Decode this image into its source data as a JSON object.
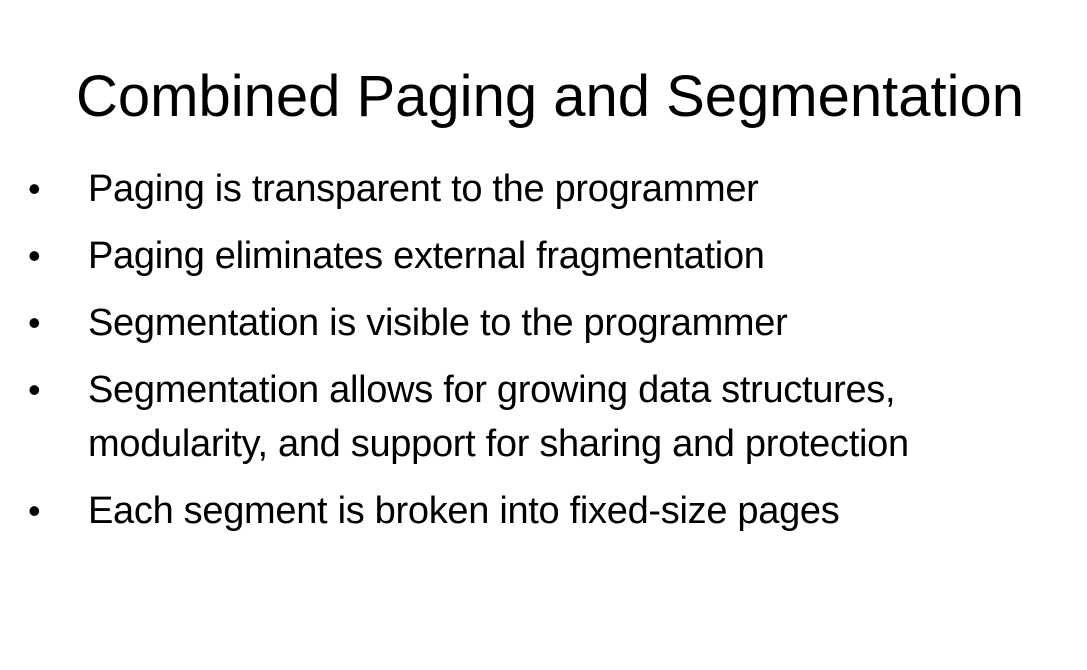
{
  "slide": {
    "title": "Combined Paging and Segmentation",
    "bullet_symbol": "•",
    "bullets": [
      {
        "text": "Paging is transparent to the programmer"
      },
      {
        "text": "Paging eliminates external fragmentation"
      },
      {
        "text": "Segmentation is visible to the programmer"
      },
      {
        "text": "Segmentation allows for growing data structures,\nmodularity, and support for sharing and protection"
      },
      {
        "text": "Each segment is broken into fixed-size pages"
      }
    ]
  }
}
